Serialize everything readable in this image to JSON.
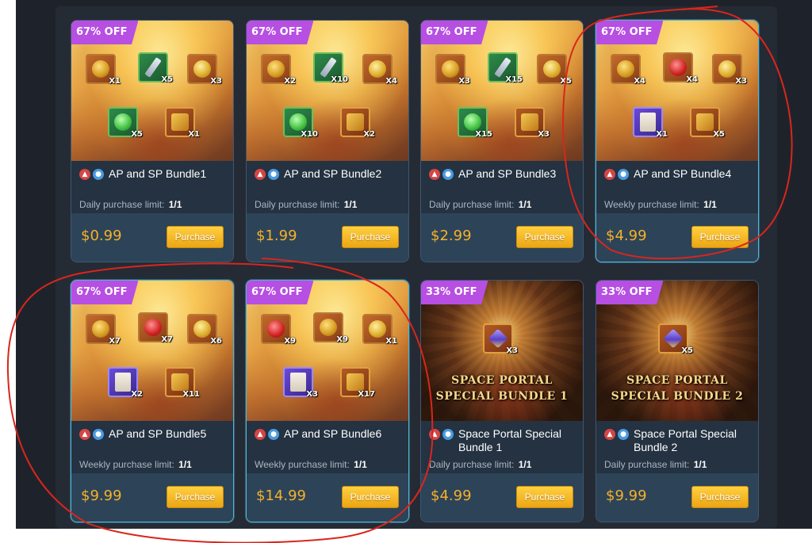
{
  "cards": [
    {
      "badge": "67% OFF",
      "name": "AP and SP Bundle1",
      "limit_label": "Daily purchase limit:",
      "limit_value": "1/1",
      "price": "$0.99",
      "button_label": "Purchase",
      "items": [
        {
          "icon": "potion-icon",
          "qty": "X1"
        },
        {
          "icon": "sword-icon",
          "qty": "X5"
        },
        {
          "icon": "coins-icon",
          "qty": "X3"
        },
        {
          "icon": "flask-icon",
          "qty": "X5"
        },
        {
          "icon": "v-emblem-icon",
          "qty": "X1"
        }
      ]
    },
    {
      "badge": "67% OFF",
      "name": "AP and SP Bundle2",
      "limit_label": "Daily purchase limit:",
      "limit_value": "1/1",
      "price": "$1.99",
      "button_label": "Purchase",
      "items": [
        {
          "icon": "potion-icon",
          "qty": "X2"
        },
        {
          "icon": "sword-icon",
          "qty": "X10"
        },
        {
          "icon": "coins-icon",
          "qty": "X4"
        },
        {
          "icon": "flask-icon",
          "qty": "X10"
        },
        {
          "icon": "v-emblem-icon",
          "qty": "X2"
        }
      ]
    },
    {
      "badge": "67% OFF",
      "name": "AP and SP Bundle3",
      "limit_label": "Daily purchase limit:",
      "limit_value": "1/1",
      "price": "$2.99",
      "button_label": "Purchase",
      "items": [
        {
          "icon": "potion-icon",
          "qty": "X3"
        },
        {
          "icon": "sword-icon",
          "qty": "X15"
        },
        {
          "icon": "coins-icon",
          "qty": "X5"
        },
        {
          "icon": "flask-icon",
          "qty": "X15"
        },
        {
          "icon": "v-emblem-icon",
          "qty": "X3"
        }
      ]
    },
    {
      "badge": "67% OFF",
      "name": "AP and SP Bundle4",
      "limit_label": "Weekly purchase limit:",
      "limit_value": "1/1",
      "price": "$4.99",
      "button_label": "Purchase",
      "items": [
        {
          "icon": "potion-icon",
          "qty": "X4"
        },
        {
          "icon": "red-potion-icon",
          "qty": "X4"
        },
        {
          "icon": "coins-icon",
          "qty": "X3"
        },
        {
          "icon": "scroll-icon",
          "qty": "X1"
        },
        {
          "icon": "v-emblem-icon",
          "qty": "X5"
        }
      ]
    },
    {
      "badge": "67% OFF",
      "name": "AP and SP Bundle5",
      "limit_label": "Weekly purchase limit:",
      "limit_value": "1/1",
      "price": "$9.99",
      "button_label": "Purchase",
      "items": [
        {
          "icon": "potion-icon",
          "qty": "X7"
        },
        {
          "icon": "red-potion-icon",
          "qty": "X7"
        },
        {
          "icon": "coins-icon",
          "qty": "X6"
        },
        {
          "icon": "scroll-icon",
          "qty": "X2"
        },
        {
          "icon": "v-emblem-icon",
          "qty": "X11"
        }
      ]
    },
    {
      "badge": "67% OFF",
      "name": "AP and SP Bundle6",
      "limit_label": "Weekly purchase limit:",
      "limit_value": "1/1",
      "price": "$14.99",
      "button_label": "Purchase",
      "items": [
        {
          "icon": "red-potion-icon",
          "qty": "X9"
        },
        {
          "icon": "potion-icon",
          "qty": "X9"
        },
        {
          "icon": "coins-icon",
          "qty": "X1"
        },
        {
          "icon": "scroll-icon",
          "qty": "X3"
        },
        {
          "icon": "v-emblem-icon",
          "qty": "X17"
        }
      ]
    },
    {
      "badge": "33% OFF",
      "name": "Space Portal Special Bundle 1",
      "art_title_line1": "SPACE PORTAL",
      "art_title_line2": "SPECIAL BUNDLE 1",
      "limit_label": "Daily purchase limit:",
      "limit_value": "1/1",
      "price": "$4.99",
      "button_label": "Purchase",
      "items": [
        {
          "icon": "portal-crystal-icon",
          "qty": "X3"
        }
      ]
    },
    {
      "badge": "33% OFF",
      "name": "Space Portal Special Bundle 2",
      "art_title_line1": "SPACE PORTAL",
      "art_title_line2": "SPECIAL BUNDLE 2",
      "limit_label": "Daily purchase limit:",
      "limit_value": "1/1",
      "price": "$9.99",
      "button_label": "Purchase",
      "items": [
        {
          "icon": "portal-crystal-icon",
          "qty": "X5"
        }
      ]
    }
  ],
  "colors": {
    "badge": "#b74fe3",
    "price": "#f5b12a",
    "button": "#f2b51d",
    "annotation": "#d9261c"
  }
}
